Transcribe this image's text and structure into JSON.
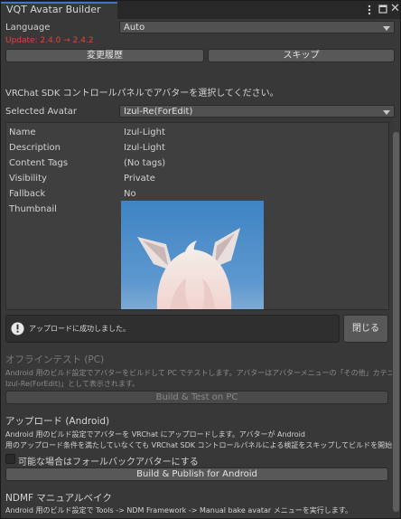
{
  "window": {
    "tab_title": "VQT Avatar Builder"
  },
  "language": {
    "label": "Language",
    "value": "Auto"
  },
  "update_notice": "Update: 2.4.0 → 2.4.2",
  "buttons": {
    "history": "変更履歴",
    "skip": "スキップ"
  },
  "intro": "VRChat SDK コントロールパネルでアバターを選択してください。",
  "selected_avatar": {
    "label": "Selected Avatar",
    "value": "Izul-Re(ForEdit)"
  },
  "details": [
    {
      "label": "Name",
      "value": "Izul-Light"
    },
    {
      "label": "Description",
      "value": "Izul-Light"
    },
    {
      "label": "Content Tags",
      "value": "(No tags)"
    },
    {
      "label": "Visibility",
      "value": "Private"
    },
    {
      "label": "Fallback",
      "value": "No"
    },
    {
      "label": "Thumbnail",
      "value": ""
    }
  ],
  "notice": {
    "message": "アップロードに成功しました。",
    "close_label": "閉じる"
  },
  "offline": {
    "title": "オフラインテスト (PC)",
    "line1": "Android 用のビルド設定でアバターをビルドして PC でテストします。アバターはアバターメニューの「その他」カテゴリに「SDK:",
    "line2": "Izul-Re(ForEdit)」として表示されます。",
    "button": "Build & Test on PC"
  },
  "upload": {
    "title": "アップロード (Android)",
    "line1": "Android 用のビルド設定でアバターを VRChat にアップロードします。アバターが Android",
    "line2": "用のアップロード条件を満たしていなくても VRChat SDK コントロールパネルによる検証をスキップしてビルドを開始します。",
    "checkbox_label": "可能な場合はフォールバックアバターにする",
    "button": "Build & Publish for Android"
  },
  "ndmf": {
    "title": "NDMF マニュアルベイク",
    "line1": "Android 用のビルド設定で Tools -> NDM Framework -> Manual bake avatar メニューを実行します。"
  }
}
